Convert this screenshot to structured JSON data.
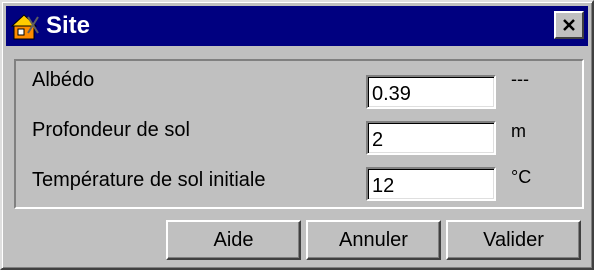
{
  "window": {
    "title": "Site",
    "app_icon": "house-tools-icon",
    "close_icon": "close-x-icon"
  },
  "rows": [
    {
      "label": "Albédo",
      "value": "0.39",
      "unit": "---"
    },
    {
      "label": "Profondeur de sol",
      "value": "2",
      "unit": "m"
    },
    {
      "label": "Température de sol initiale",
      "value": "12",
      "unit": "°C"
    }
  ],
  "buttons": {
    "aide": "Aide",
    "annuler": "Annuler",
    "valider": "Valider"
  },
  "colors": {
    "titlebar": "#000080",
    "face": "#c0c0c0"
  }
}
